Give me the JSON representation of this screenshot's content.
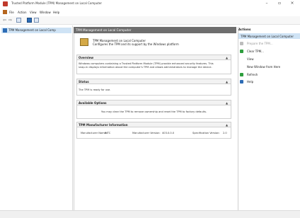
{
  "window": {
    "title": "Trusted Platform Module (TPM) Management on Local Computer",
    "minimize": "–",
    "maximize": "▫",
    "close": "×"
  },
  "menu": {
    "items": [
      "File",
      "Action",
      "View",
      "Window",
      "Help"
    ]
  },
  "toolbar": {
    "back": "⇦",
    "forward": "⇨"
  },
  "tree": {
    "selected_label": "TPM Management on Local Comp"
  },
  "main": {
    "header": "TPM Management on Local Computer",
    "info_title": "TPM Management on Local Computer",
    "info_subtitle": "Configures the TPM and its support by the Windows platform",
    "sections": {
      "overview": {
        "title": "Overview",
        "line1": "Windows computers containing a Trusted Platform Module (TPM) provide enhanced security features. This",
        "line2": "snap-in displays information about the computer's TPM and allows administrators to manage the device."
      },
      "status": {
        "title": "Status",
        "line1": "The TPM is ready for use."
      },
      "available_options": {
        "title": "Available Options",
        "line1": "You may clear the TPM to remove ownership and reset the TPM to factory defaults."
      },
      "manufacturer": {
        "title": "TPM Manufacturer Information",
        "manufacturer_name_label": "Manufacturer Name:",
        "manufacturer_name_value": "INTC",
        "manufacturer_version_label": "Manufacturer Version:",
        "manufacturer_version_value": "403.0.0.0",
        "spec_version_label": "Specification Version:",
        "spec_version_value": "2.0"
      }
    }
  },
  "actions": {
    "header": "Actions",
    "selected": "TPM Management on Local Computer",
    "items": [
      {
        "label": "Prepare the TPM...",
        "disabled": true
      },
      {
        "label": "Clear TPM...",
        "disabled": false
      },
      {
        "label": "View",
        "disabled": false
      },
      {
        "label": "New Window from Here",
        "disabled": false
      },
      {
        "label": "Refresh",
        "disabled": false
      },
      {
        "label": "Help",
        "disabled": false
      }
    ]
  },
  "colors": {
    "header_bg": "#6e6e6e",
    "selection_bg": "#cfe3f5",
    "accent_green": "#2e9e3e",
    "accent_blue": "#2d6cb5"
  }
}
